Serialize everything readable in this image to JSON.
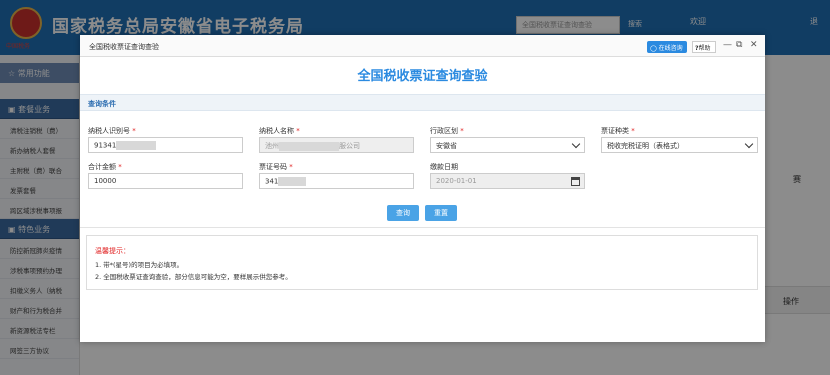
{
  "background": {
    "header_title": "国家税务总局安徽省电子税务局",
    "emblem_subtitle": "中国税务",
    "search_placeholder": "全国税收票证查询查验",
    "search_button": "搜索",
    "welcome_text": "欢迎",
    "logout_text": "退",
    "sidebar": {
      "groups": [
        {
          "label": "常用功能"
        },
        {
          "label": "套餐业务"
        },
        {
          "label": "特色业务"
        }
      ],
      "items_group2": [
        "清税注销税（费）",
        "新办纳税人套餐",
        "主附税（费）联合",
        "发票套餐",
        "跨区域涉税事项报"
      ],
      "items_group3": [
        "防控新冠肺炎疫情",
        "涉税事项预约办理",
        "扣缴义务人（纳税",
        "财产和行为税合并",
        "新资源税法专栏",
        "网签三方协议"
      ]
    },
    "operation_label": "操作",
    "right_fragment": "赛"
  },
  "modal": {
    "window_title": "全国税收票证查询查验",
    "online_button": "在线咨询",
    "help_button": "帮助",
    "heading": "全国税收票证查询查验",
    "section_label": "查询条件",
    "fields": {
      "taxpayer_id": {
        "label": "纳税人识别号",
        "value_prefix": "91341"
      },
      "taxpayer_name": {
        "label": "纳税人名称",
        "value_prefix": "池州",
        "value_suffix": "服公司"
      },
      "region": {
        "label": "行政区划",
        "value": "安徽省"
      },
      "cert_type": {
        "label": "票证种类",
        "value": "税收完税证明（表格式）"
      },
      "total_amount": {
        "label": "合计金额",
        "value": "10000"
      },
      "cert_number": {
        "label": "票证号码",
        "value_prefix": "341"
      },
      "payment_date": {
        "label": "缴款日期",
        "value": "2020-01-01"
      }
    },
    "required_mark": "*",
    "query_button": "查询",
    "reset_button": "重置",
    "tips": {
      "title": "温馨提示：",
      "lines": [
        "1. 带*(星号)的项目为必填项。",
        "2. 全国税收票证查询查验，部分信息可能为空，要样展示供您参考。"
      ]
    }
  }
}
